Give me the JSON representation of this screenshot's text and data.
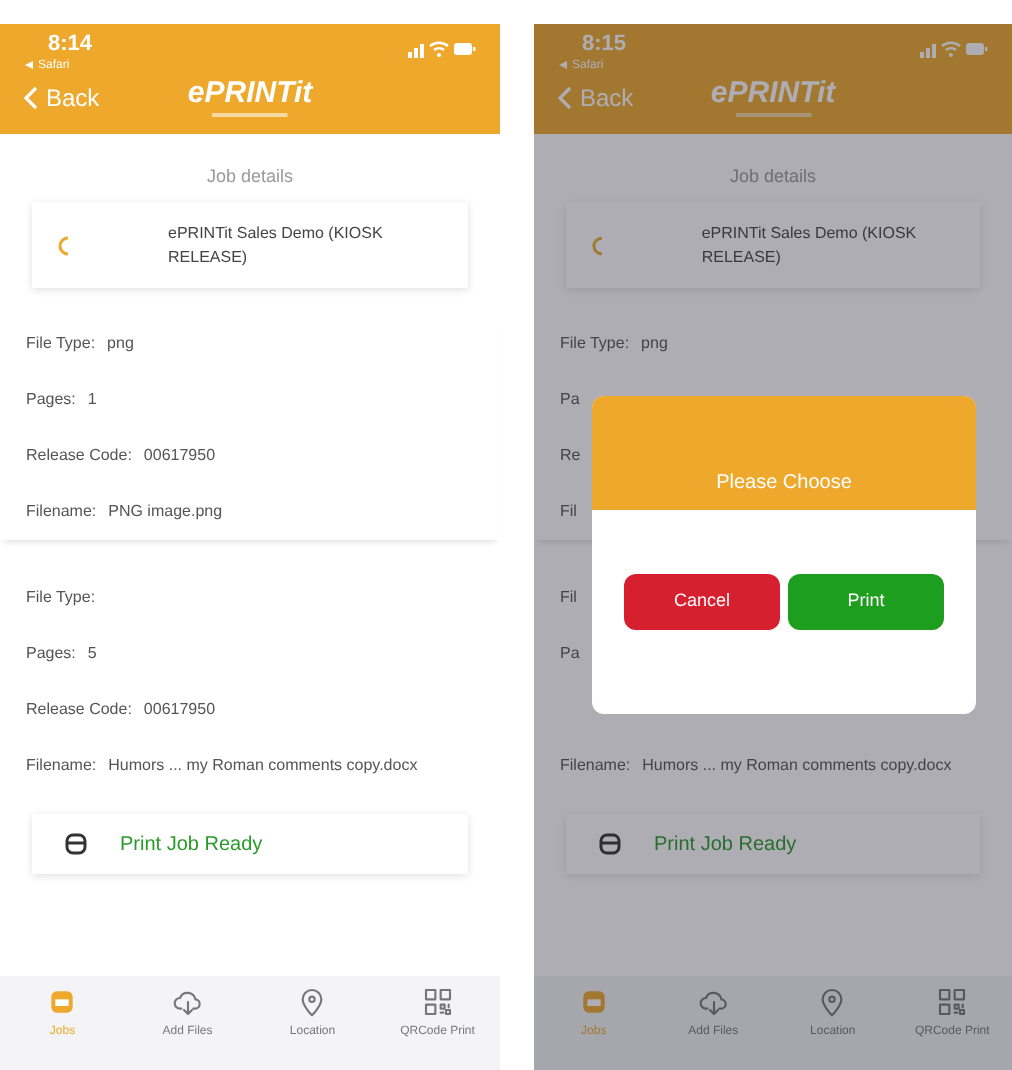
{
  "screens": [
    {
      "status": {
        "time": "8:14",
        "back_app": "Safari"
      },
      "nav": {
        "back": "Back",
        "logo": "ePRINTit"
      },
      "title": "Job details",
      "job": {
        "name": "ePRINTit Sales Demo (KIOSK RELEASE)"
      },
      "sections": [
        [
          {
            "label": "File Type:",
            "value": "png"
          },
          {
            "label": "Pages:",
            "value": "1"
          },
          {
            "label": "Release Code:",
            "value": "00617950"
          },
          {
            "label": "Filename:",
            "value": "PNG image.png"
          }
        ],
        [
          {
            "label": "File Type:"
          },
          {
            "label": "Pages:",
            "value": "5"
          },
          {
            "label": "Release Code:",
            "value": "00617950"
          },
          {
            "label": "Filename:",
            "value": "Humors ... my Roman comments copy.docx"
          }
        ]
      ],
      "ready": "Print Job Ready",
      "tabs": [
        {
          "label": "Jobs",
          "selected": true
        },
        {
          "label": "Add Files",
          "selected": false
        },
        {
          "label": "Location",
          "selected": false
        },
        {
          "label": "QRCode Print",
          "selected": false
        }
      ]
    },
    {
      "status": {
        "time": "8:15",
        "back_app": "Safari"
      },
      "nav": {
        "back": "Back",
        "logo": "ePRINTit"
      },
      "title": "Job details",
      "job": {
        "name": "ePRINTit Sales Demo (KIOSK RELEASE)"
      },
      "sections": [
        [
          {
            "label": "File Type:",
            "value": "png"
          },
          {
            "label": "Pa"
          },
          {
            "label": "Re"
          },
          {
            "label": "Fil"
          }
        ],
        [
          {
            "label": "Fil"
          },
          {
            "label": "Pa"
          },
          {
            "label": "Filename:",
            "value": "Humors ... my Roman comments copy.docx"
          }
        ]
      ],
      "ready": "Print Job Ready",
      "tabs": [
        {
          "label": "Jobs",
          "selected": true
        },
        {
          "label": "Add Files",
          "selected": false
        },
        {
          "label": "Location",
          "selected": false
        },
        {
          "label": "QRCode Print",
          "selected": false
        }
      ],
      "dialog": {
        "title": "Please Choose",
        "buttons": [
          {
            "label": "Cancel",
            "kind": "cancel"
          },
          {
            "label": "Print",
            "kind": "confirm"
          }
        ]
      }
    }
  ]
}
